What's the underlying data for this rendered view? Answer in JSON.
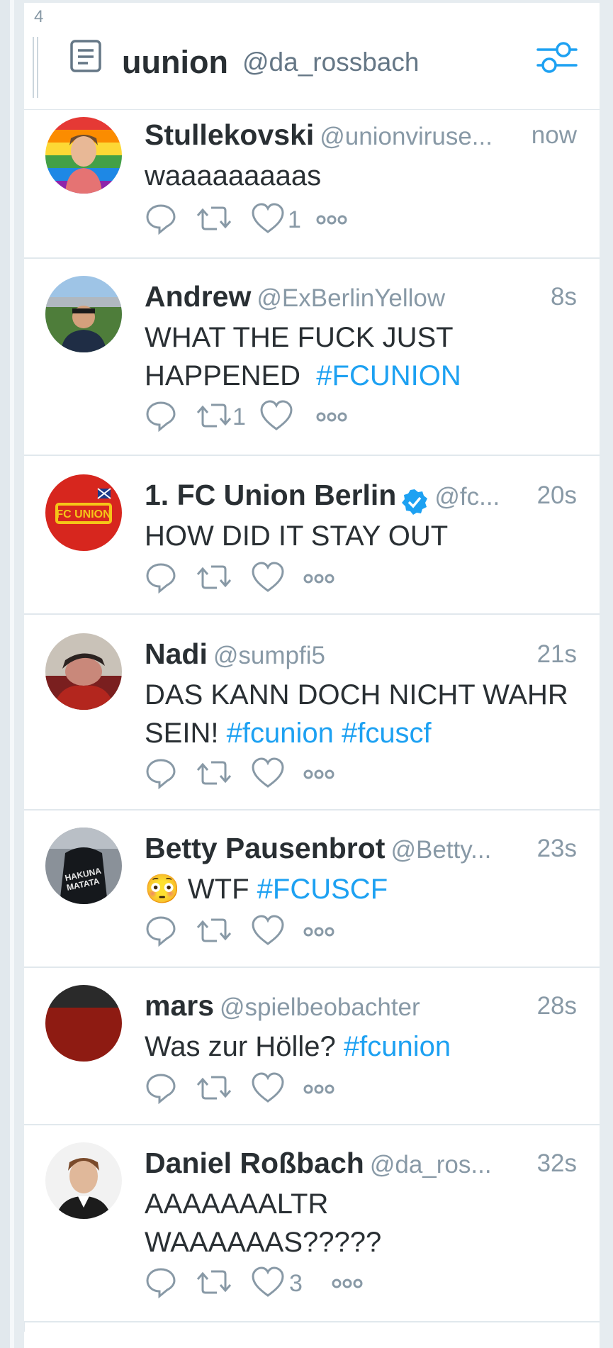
{
  "column": {
    "number": "4",
    "title": "uunion",
    "handle": "@da_rossbach"
  },
  "colors": {
    "accent": "#1da1f2",
    "text": "#292f33",
    "muted": "#8899a6"
  },
  "tweets": [
    {
      "name": "Stullekovski",
      "handle": "@unionviruse...",
      "time": "now",
      "text_plain": "waaaaaaaaas",
      "text_tag": "",
      "retweets": "",
      "likes": "1",
      "verified": false
    },
    {
      "name": "Andrew",
      "handle": "@ExBerlinYellow",
      "time": "8s",
      "text_plain": "WHAT THE FUCK JUST HAPPENED",
      "text_tag": "#FCUNION",
      "retweets": "1",
      "likes": "",
      "verified": false
    },
    {
      "name": "1. FC Union Berlin",
      "handle": "@fc...",
      "time": "20s",
      "text_plain": "HOW DID IT STAY OUT",
      "text_tag": "",
      "retweets": "",
      "likes": "",
      "verified": true
    },
    {
      "name": "Nadi",
      "handle": "@sumpfi5",
      "time": "21s",
      "text_plain": "DAS KANN DOCH NICHT WAHR SEIN!",
      "text_tag": "#fcunion #fcuscf",
      "retweets": "",
      "likes": "",
      "verified": false
    },
    {
      "name": "Betty Pausenbrot",
      "handle": "@Betty...",
      "time": "23s",
      "text_plain": "😳 WTF",
      "text_tag": "#FCUSCF",
      "retweets": "",
      "likes": "",
      "verified": false
    },
    {
      "name": "mars",
      "handle": "@spielbeobachter",
      "time": "28s",
      "text_plain": "Was zur Hölle?",
      "text_tag": "#fcunion",
      "retweets": "",
      "likes": "",
      "verified": false
    },
    {
      "name": "Daniel Roßbach",
      "handle": "@da_ros...",
      "time": "32s",
      "text_plain": "AAAAAAALTR WAAAAAAS?????",
      "text_tag": "",
      "retweets": "",
      "likes": "3",
      "verified": false
    }
  ]
}
